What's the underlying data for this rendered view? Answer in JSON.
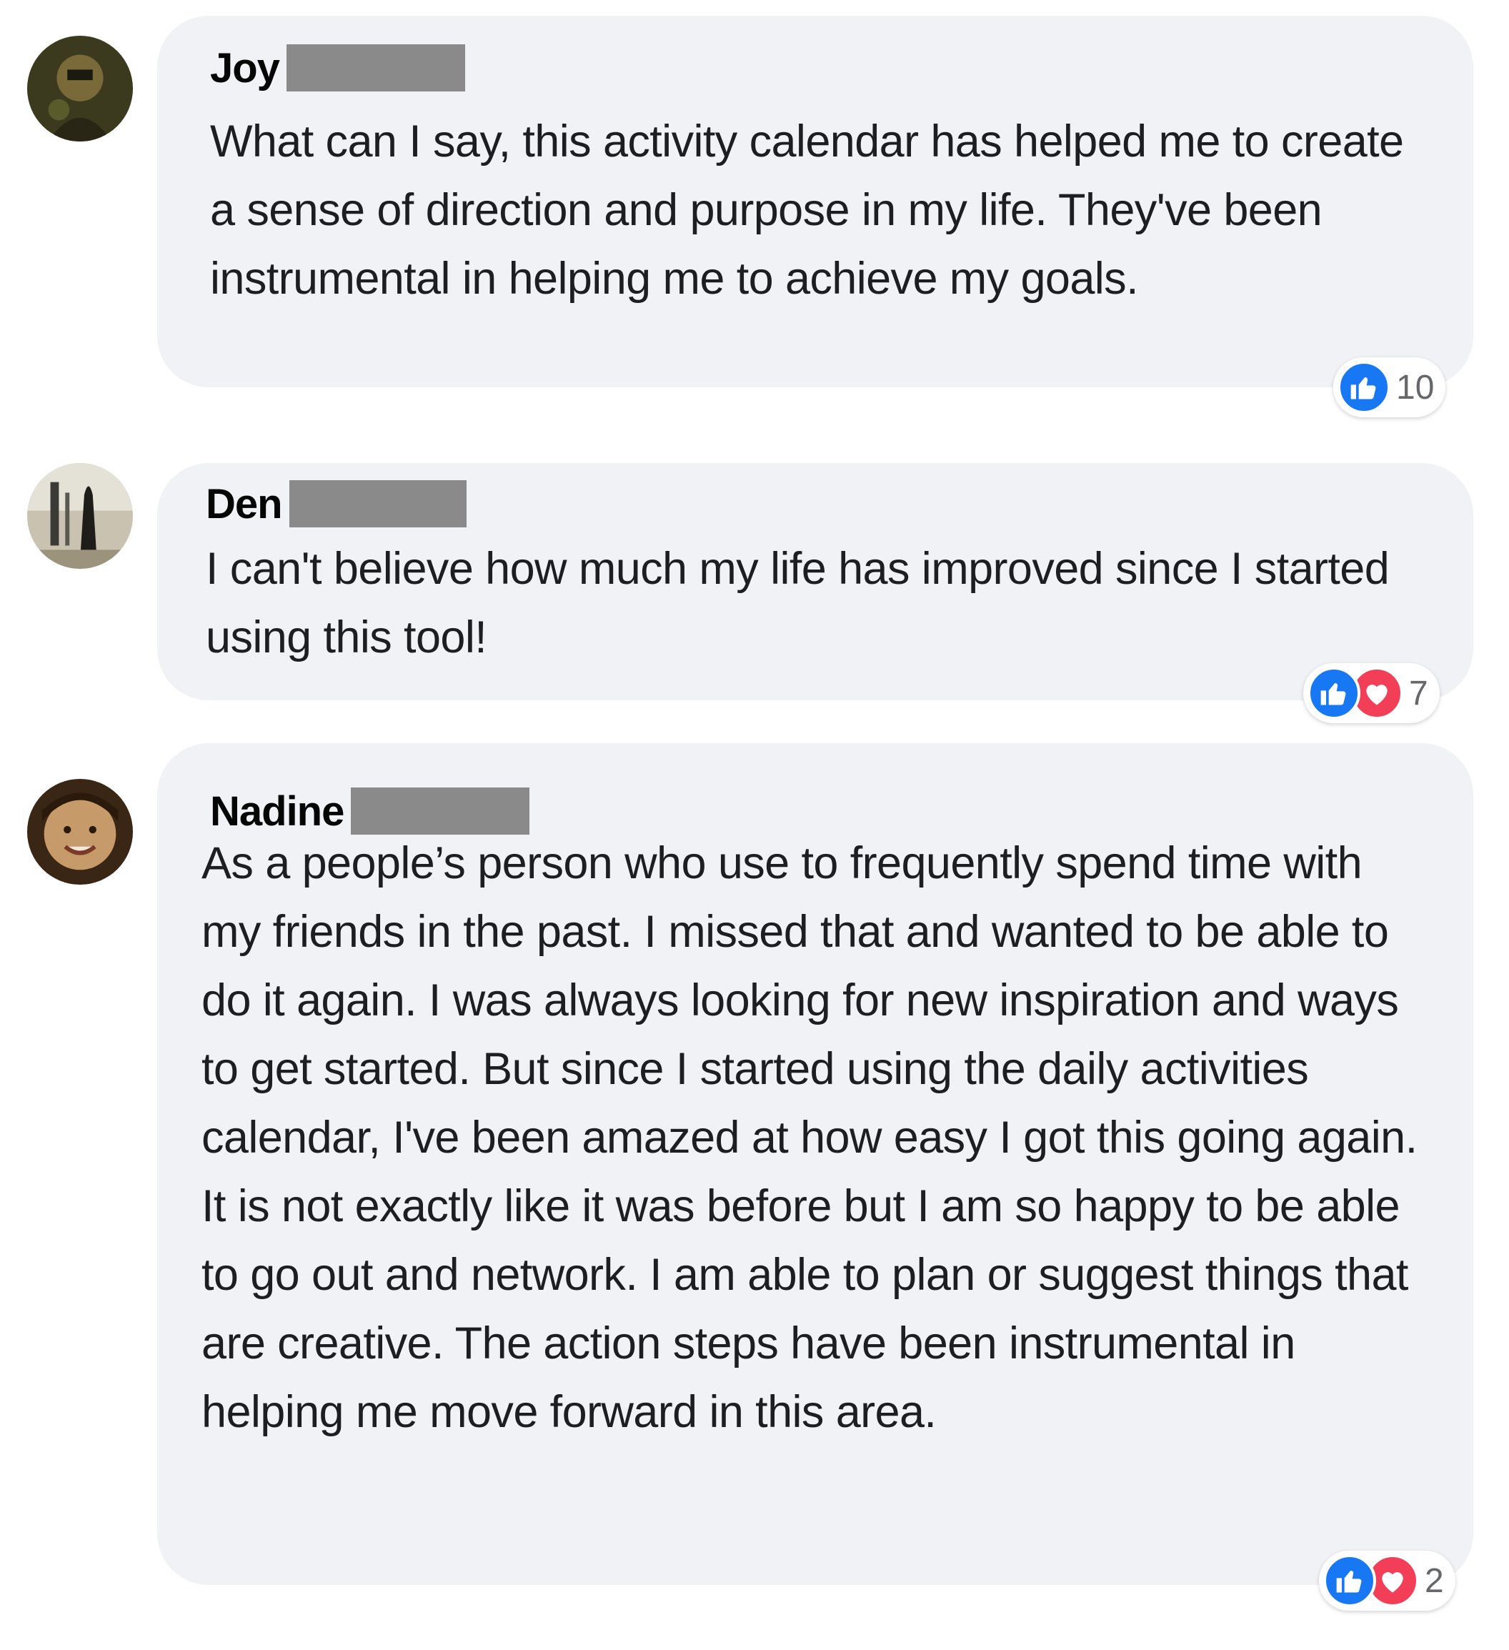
{
  "colors": {
    "bubble_bg": "#f0f2f5",
    "like_blue": "#1877f2",
    "love_red": "#f33e58",
    "count_gray": "#65676b",
    "redaction_gray": "#8a8a8a"
  },
  "comments": [
    {
      "author_first_name": "Joy",
      "author_last_name_redacted": true,
      "text": "What can I say, this activity calendar has helped me to create a sense of direction and purpose in my life. They've been instrumental in helping me to achieve my goals.",
      "reactions": {
        "icons": [
          "like-icon"
        ],
        "count": "10"
      }
    },
    {
      "author_first_name": "Den",
      "author_last_name_redacted": true,
      "text": "I can't believe how much my life has improved since I started using this tool!",
      "reactions": {
        "icons": [
          "like-icon",
          "love-icon"
        ],
        "count": "7"
      }
    },
    {
      "author_first_name": "Nadine",
      "author_last_name_redacted": true,
      "text": "As a people’s person who use to frequently spend time with my friends in the past. I missed that and wanted to be able to do it again. I was always looking for new inspiration and ways to get started. But since I started using the daily activities calendar, I've been amazed at how easy I got this going again. It is not exactly like it was before but I am so happy to be able to go out and network. I am able to plan or suggest things that are creative. The action steps have been instrumental in helping me move forward in this area.",
      "reactions": {
        "icons": [
          "like-icon",
          "love-icon"
        ],
        "count": "2"
      }
    }
  ]
}
